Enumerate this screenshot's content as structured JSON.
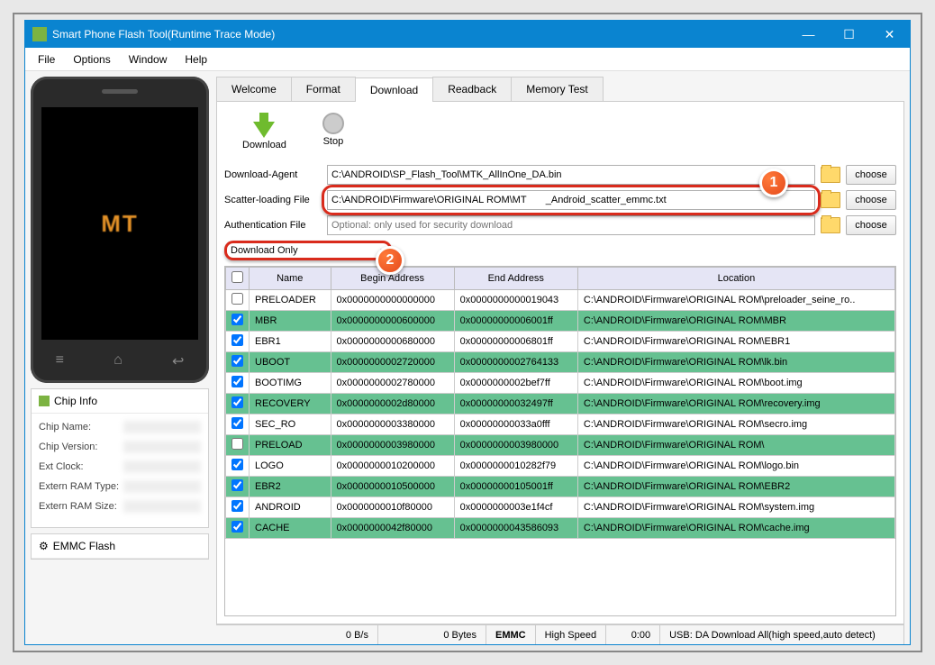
{
  "window": {
    "title": "Smart Phone Flash Tool(Runtime Trace Mode)"
  },
  "menu": {
    "file": "File",
    "options": "Options",
    "window": "Window",
    "help": "Help"
  },
  "sidebar": {
    "phone_text": "MT",
    "chipinfo_title": "Chip Info",
    "rows": [
      {
        "label": "Chip Name:"
      },
      {
        "label": "Chip Version:"
      },
      {
        "label": "Ext Clock:"
      },
      {
        "label": "Extern RAM Type:"
      },
      {
        "label": "Extern RAM Size:"
      }
    ],
    "emmc_title": "EMMC Flash"
  },
  "tabs": {
    "welcome": "Welcome",
    "format": "Format",
    "download": "Download",
    "readback": "Readback",
    "memtest": "Memory Test"
  },
  "toolbar": {
    "download": "Download",
    "stop": "Stop"
  },
  "form": {
    "da_label": "Download-Agent",
    "da_value": "C:\\ANDROID\\SP_Flash_Tool\\MTK_AllInOne_DA.bin",
    "scatter_label": "Scatter-loading File",
    "scatter_value": "C:\\ANDROID\\Firmware\\ORIGINAL ROM\\MT       _Android_scatter_emmc.txt",
    "auth_label": "Authentication File",
    "auth_placeholder": "Optional: only used for security download",
    "choose": "choose",
    "download_only": "Download Only"
  },
  "callouts": {
    "one": "1",
    "two": "2"
  },
  "table": {
    "headers": {
      "name": "Name",
      "begin": "Begin Address",
      "end": "End Address",
      "loc": "Location"
    },
    "rows": [
      {
        "chk": false,
        "green": false,
        "name": "PRELOADER",
        "begin": "0x0000000000000000",
        "end": "0x0000000000019043",
        "loc": "C:\\ANDROID\\Firmware\\ORIGINAL ROM\\preloader_seine_ro.."
      },
      {
        "chk": true,
        "green": true,
        "name": "MBR",
        "begin": "0x0000000000600000",
        "end": "0x00000000006001ff",
        "loc": "C:\\ANDROID\\Firmware\\ORIGINAL ROM\\MBR"
      },
      {
        "chk": true,
        "green": false,
        "name": "EBR1",
        "begin": "0x0000000000680000",
        "end": "0x00000000006801ff",
        "loc": "C:\\ANDROID\\Firmware\\ORIGINAL ROM\\EBR1"
      },
      {
        "chk": true,
        "green": true,
        "name": "UBOOT",
        "begin": "0x0000000002720000",
        "end": "0x0000000002764133",
        "loc": "C:\\ANDROID\\Firmware\\ORIGINAL ROM\\lk.bin"
      },
      {
        "chk": true,
        "green": false,
        "name": "BOOTIMG",
        "begin": "0x0000000002780000",
        "end": "0x0000000002bef7ff",
        "loc": "C:\\ANDROID\\Firmware\\ORIGINAL ROM\\boot.img"
      },
      {
        "chk": true,
        "green": true,
        "name": "RECOVERY",
        "begin": "0x0000000002d80000",
        "end": "0x00000000032497ff",
        "loc": "C:\\ANDROID\\Firmware\\ORIGINAL ROM\\recovery.img"
      },
      {
        "chk": true,
        "green": false,
        "name": "SEC_RO",
        "begin": "0x0000000003380000",
        "end": "0x00000000033a0fff",
        "loc": "C:\\ANDROID\\Firmware\\ORIGINAL ROM\\secro.img"
      },
      {
        "chk": false,
        "green": true,
        "name": "PRELOAD",
        "begin": "0x0000000003980000",
        "end": "0x0000000003980000",
        "loc": "C:\\ANDROID\\Firmware\\ORIGINAL ROM\\"
      },
      {
        "chk": true,
        "green": false,
        "name": "LOGO",
        "begin": "0x0000000010200000",
        "end": "0x0000000010282f79",
        "loc": "C:\\ANDROID\\Firmware\\ORIGINAL ROM\\logo.bin"
      },
      {
        "chk": true,
        "green": true,
        "name": "EBR2",
        "begin": "0x0000000010500000",
        "end": "0x00000000105001ff",
        "loc": "C:\\ANDROID\\Firmware\\ORIGINAL ROM\\EBR2"
      },
      {
        "chk": true,
        "green": false,
        "name": "ANDROID",
        "begin": "0x0000000010f80000",
        "end": "0x0000000003e1f4cf",
        "loc": "C:\\ANDROID\\Firmware\\ORIGINAL ROM\\system.img"
      },
      {
        "chk": true,
        "green": true,
        "name": "CACHE",
        "begin": "0x0000000042f80000",
        "end": "0x0000000043586093",
        "loc": "C:\\ANDROID\\Firmware\\ORIGINAL ROM\\cache.img"
      }
    ]
  },
  "status": {
    "speed": "0 B/s",
    "bytes": "0 Bytes",
    "storage": "EMMC",
    "mode": "High Speed",
    "time": "0:00",
    "usb": "USB: DA Download All(high speed,auto detect)"
  }
}
